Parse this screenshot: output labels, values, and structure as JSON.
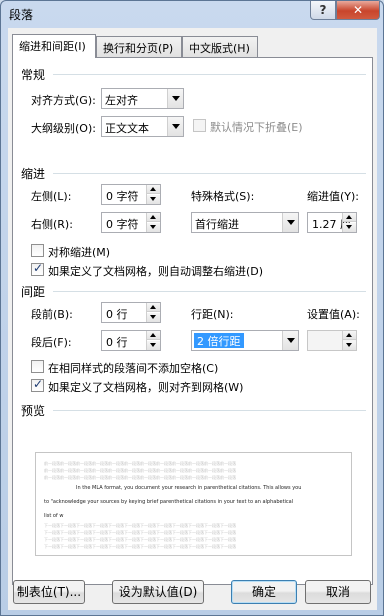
{
  "window": {
    "title": "段落",
    "help": "?",
    "close": "✕"
  },
  "tabs": [
    {
      "label": "缩进和间距(I)"
    },
    {
      "label": "换行和分页(P)"
    },
    {
      "label": "中文版式(H)"
    }
  ],
  "general": {
    "title": "常规",
    "alignment_label": "对齐方式(G):",
    "alignment_value": "左对齐",
    "outline_label": "大纲级别(O):",
    "outline_value": "正文文本",
    "collapse_label": "默认情况下折叠(E)",
    "collapse_checked": false
  },
  "indent": {
    "title": "缩进",
    "left_label": "左侧(L):",
    "left_value": "0 字符",
    "right_label": "右侧(R):",
    "right_value": "0 字符",
    "special_label": "特殊格式(S):",
    "special_value": "首行缩进",
    "by_label": "缩进值(Y):",
    "by_value": "1.27 厘",
    "mirror_label": "对称缩进(M)",
    "mirror_checked": false,
    "auto_adjust_label": "如果定义了文档网格，则自动调整右缩进(D)",
    "auto_adjust_checked": true
  },
  "spacing": {
    "title": "间距",
    "before_label": "段前(B):",
    "before_value": "0 行",
    "after_label": "段后(F):",
    "after_value": "0 行",
    "line_label": "行距(N):",
    "line_value": "2 倍行距",
    "at_label": "设置值(A):",
    "at_value": "",
    "no_space_label": "在相同样式的段落间不添加空格(C)",
    "no_space_checked": false,
    "snap_grid_label": "如果定义了文档网格，则对齐到网格(W)",
    "snap_grid_checked": true
  },
  "preview": {
    "title": "预览",
    "prev_para_text": "前一段落前一段落前一段落前一段落前一段落前一段落前一段落前一段落前一段落前一段落前一段落前一段落",
    "sample_line1": "In the MLA format, you document your research in parenthetical citations. This allows you",
    "sample_line2": "to \"acknowledge your sources by keying brief parenthetical citations in your text to an alphabetical",
    "sample_line3": "list of w",
    "next_para_text": "下一段落下一段落下一段落下一段落下一段落下一段落下一段落下一段落下一段落下一段落下一段落下一段落"
  },
  "buttons": {
    "tabs": "制表位(T)...",
    "set_default": "设为默认值(D)",
    "ok": "确定",
    "cancel": "取消"
  }
}
